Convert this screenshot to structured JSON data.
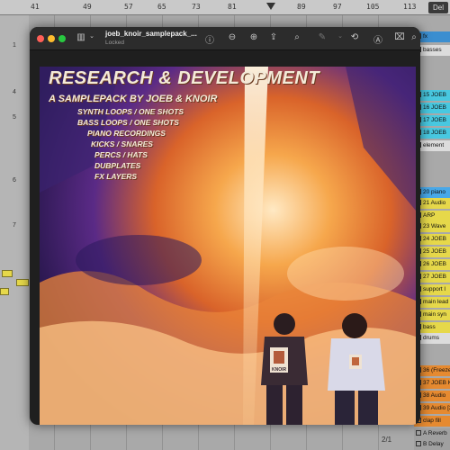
{
  "daw": {
    "ruler_numbers": [
      "41",
      "49",
      "57",
      "65",
      "73",
      "81",
      "89",
      "97",
      "105",
      "113"
    ],
    "delete_label": "Del",
    "left_ticks": [
      "1",
      "4",
      "5",
      "6",
      "7"
    ],
    "page_indicator": "2/1",
    "tracks": [
      {
        "label": "fx",
        "color": "#3b8ed0"
      },
      {
        "label": "basses",
        "color": "#dcdcdc"
      },
      {
        "label": "15 JOEB",
        "color": "#48c8e0"
      },
      {
        "label": "16 JOEB",
        "color": "#48c8e0"
      },
      {
        "label": "17 JOEB",
        "color": "#48c8e0"
      },
      {
        "label": "18 JOEB",
        "color": "#48c8e0"
      },
      {
        "label": "element",
        "color": "#dcdcdc"
      },
      {
        "label": "20 piano",
        "color": "#48a8e8"
      },
      {
        "label": "21 Audio",
        "color": "#e6d84a"
      },
      {
        "label": "ARP",
        "color": "#e6d84a"
      },
      {
        "label": "23 Wave",
        "color": "#e6d84a"
      },
      {
        "label": "24 JOEB",
        "color": "#e6d84a"
      },
      {
        "label": "25 JOEB",
        "color": "#e6d84a"
      },
      {
        "label": "26 JOEB",
        "color": "#e6d84a"
      },
      {
        "label": "27 JOEB",
        "color": "#e6d84a"
      },
      {
        "label": "support l",
        "color": "#e6d84a"
      },
      {
        "label": "main lead",
        "color": "#e6d84a"
      },
      {
        "label": "main syn",
        "color": "#e6d84a"
      },
      {
        "label": "bass",
        "color": "#e6d84a"
      },
      {
        "label": "drums",
        "color": "#dcdcdc"
      },
      {
        "label": "36 (Freeze)",
        "color": "#e68a30"
      },
      {
        "label": "37 JOEB K",
        "color": "#e68a30"
      },
      {
        "label": "38 Audio",
        "color": "#e68a30"
      },
      {
        "label": "39 Audio [2]",
        "color": "#e68a30"
      },
      {
        "label": "clap fill",
        "color": "#e68a30"
      },
      {
        "label": "A Reverb",
        "color": "#a0a0a0"
      },
      {
        "label": "B Delay",
        "color": "#a0a0a0"
      },
      {
        "label": "Main",
        "color": "#e6d84a"
      }
    ]
  },
  "preview": {
    "filename": "joeb_knoir_samplepack_...",
    "status": "Locked",
    "accent_colors": {
      "close": "#ff5f57",
      "minimize": "#febc2e",
      "zoom": "#28c840"
    }
  },
  "cover": {
    "title": "RESEARCH & DEVELOPMENT",
    "subtitle": "A SAMPLEPACK BY JOEB & KNOIR",
    "contents": [
      "SYNTH LOOPS / ONE SHOTS",
      "BASS LOOPS / ONE SHOTS",
      "PIANO RECORDINGS",
      "KICKS / SNARES",
      "PERCS / HATS",
      "DUBPLATES",
      "FX LAYERS"
    ],
    "badge_text": "KNOIR"
  }
}
